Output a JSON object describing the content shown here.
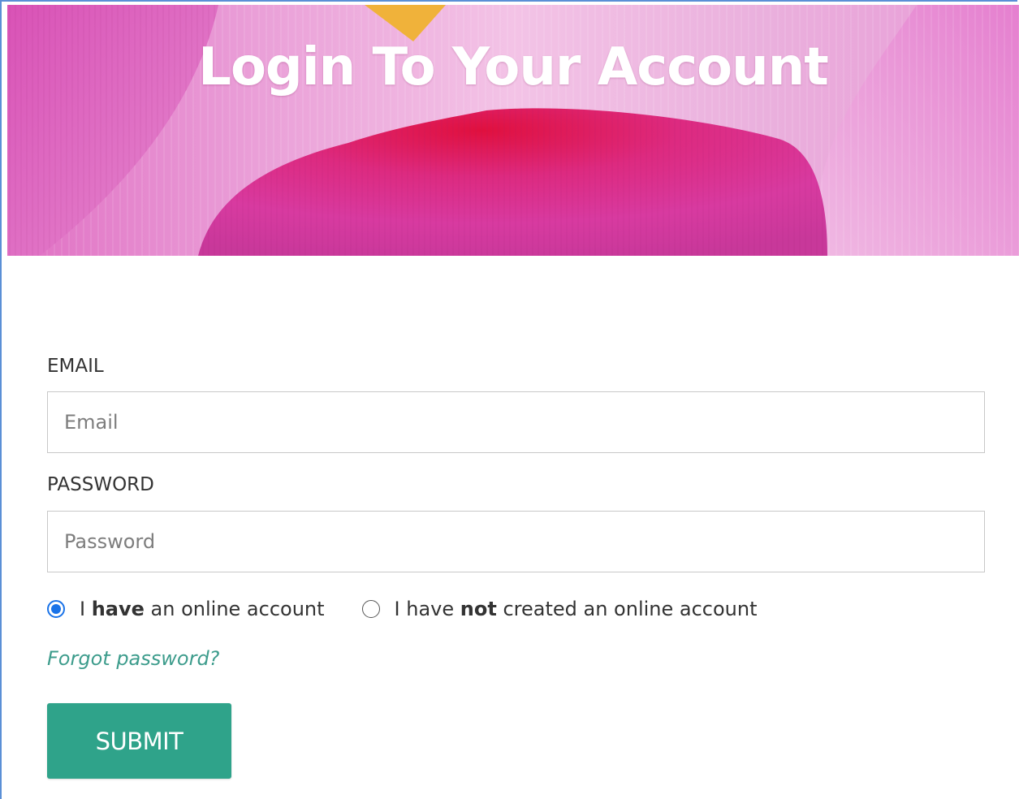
{
  "banner": {
    "title": "Login To Your Account"
  },
  "form": {
    "email": {
      "label": "EMAIL",
      "placeholder": "Email",
      "value": ""
    },
    "password": {
      "label": "PASSWORD",
      "placeholder": "Password",
      "value": ""
    },
    "account_options": [
      {
        "prefix": "I ",
        "bold": "have",
        "suffix": " an online account",
        "checked": true
      },
      {
        "prefix": "I have ",
        "bold": "not",
        "suffix": " created an online account",
        "checked": false
      }
    ],
    "forgot_password_label": "Forgot password?",
    "submit_label": "SUBMIT"
  },
  "colors": {
    "accent": "#2fa38a",
    "link": "#3d9c8c",
    "radio_checked": "#1a73e8",
    "banner_pink": "#e0259a"
  }
}
